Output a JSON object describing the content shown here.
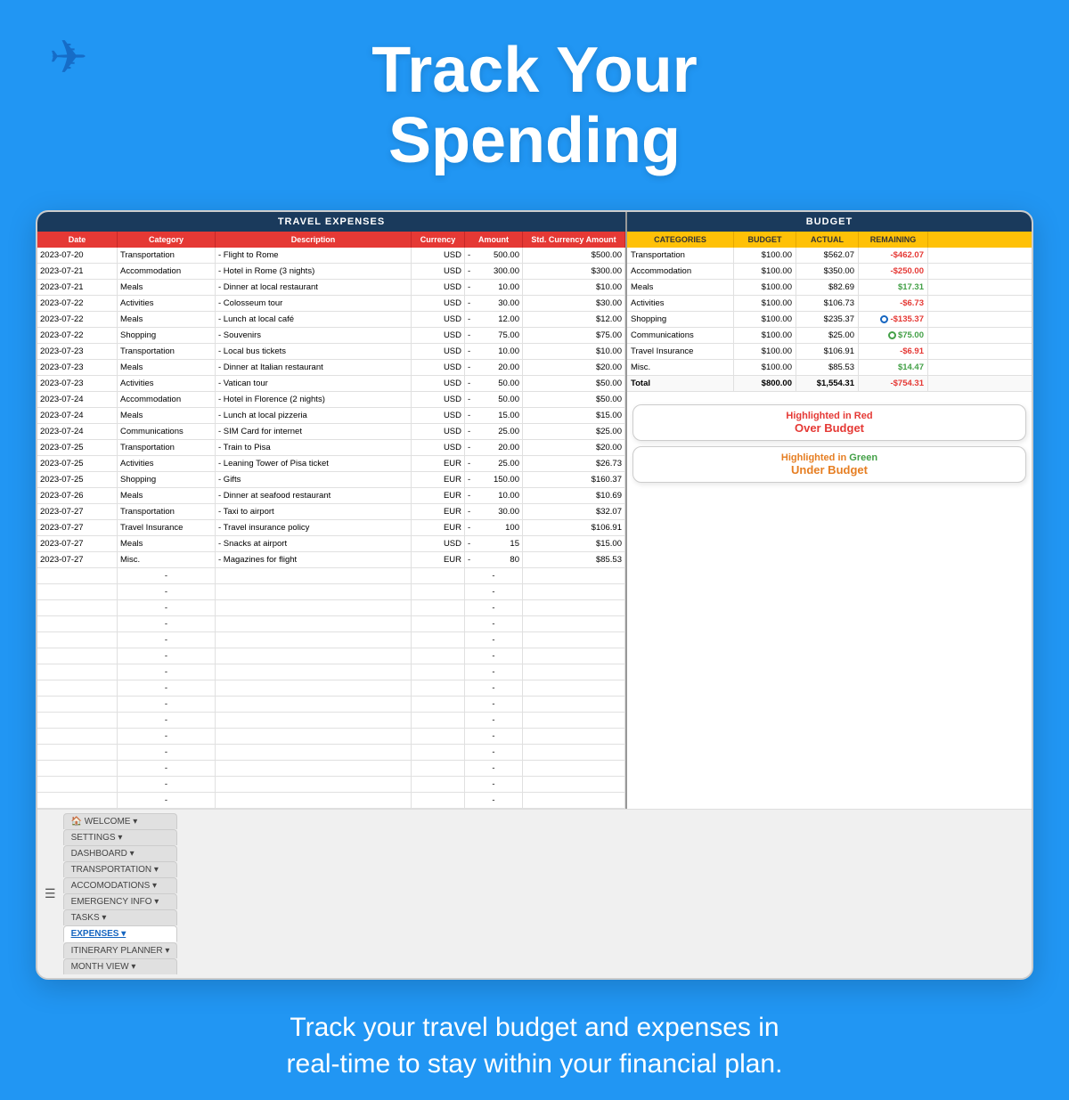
{
  "header": {
    "title_line1": "Track Your",
    "title_line2": "Spending"
  },
  "left_panel": {
    "title": "TRAVEL EXPENSES",
    "columns": [
      "Date",
      "Category",
      "Description",
      "Currency",
      "Amount",
      "Std. Currency Amount"
    ],
    "rows": [
      {
        "date": "2023-07-20",
        "category": "Transportation",
        "description": "- Flight to Rome",
        "currency": "USD",
        "dash": "-",
        "amount": "500.00",
        "std": "$500.00"
      },
      {
        "date": "2023-07-21",
        "category": "Accommodation",
        "description": "- Hotel in Rome (3 nights)",
        "currency": "USD",
        "dash": "-",
        "amount": "300.00",
        "std": "$300.00"
      },
      {
        "date": "2023-07-21",
        "category": "Meals",
        "description": "- Dinner at local restaurant",
        "currency": "USD",
        "dash": "-",
        "amount": "10.00",
        "std": "$10.00"
      },
      {
        "date": "2023-07-22",
        "category": "Activities",
        "description": "- Colosseum tour",
        "currency": "USD",
        "dash": "-",
        "amount": "30.00",
        "std": "$30.00"
      },
      {
        "date": "2023-07-22",
        "category": "Meals",
        "description": "- Lunch at local café",
        "currency": "USD",
        "dash": "-",
        "amount": "12.00",
        "std": "$12.00"
      },
      {
        "date": "2023-07-22",
        "category": "Shopping",
        "description": "- Souvenirs",
        "currency": "USD",
        "dash": "-",
        "amount": "75.00",
        "std": "$75.00"
      },
      {
        "date": "2023-07-23",
        "category": "Transportation",
        "description": "- Local bus tickets",
        "currency": "USD",
        "dash": "-",
        "amount": "10.00",
        "std": "$10.00"
      },
      {
        "date": "2023-07-23",
        "category": "Meals",
        "description": "- Dinner at Italian restaurant",
        "currency": "USD",
        "dash": "-",
        "amount": "20.00",
        "std": "$20.00"
      },
      {
        "date": "2023-07-23",
        "category": "Activities",
        "description": "- Vatican tour",
        "currency": "USD",
        "dash": "-",
        "amount": "50.00",
        "std": "$50.00"
      },
      {
        "date": "2023-07-24",
        "category": "Accommodation",
        "description": "- Hotel in Florence (2 nights)",
        "currency": "USD",
        "dash": "-",
        "amount": "50.00",
        "std": "$50.00"
      },
      {
        "date": "2023-07-24",
        "category": "Meals",
        "description": "- Lunch at local pizzeria",
        "currency": "USD",
        "dash": "-",
        "amount": "15.00",
        "std": "$15.00"
      },
      {
        "date": "2023-07-24",
        "category": "Communications",
        "description": "- SIM Card for internet",
        "currency": "USD",
        "dash": "-",
        "amount": "25.00",
        "std": "$25.00"
      },
      {
        "date": "2023-07-25",
        "category": "Transportation",
        "description": "- Train to Pisa",
        "currency": "USD",
        "dash": "-",
        "amount": "20.00",
        "std": "$20.00"
      },
      {
        "date": "2023-07-25",
        "category": "Activities",
        "description": "- Leaning Tower of Pisa ticket",
        "currency": "EUR",
        "dash": "-",
        "amount": "25.00",
        "std": "$26.73"
      },
      {
        "date": "2023-07-25",
        "category": "Shopping",
        "description": "- Gifts",
        "currency": "EUR",
        "dash": "-",
        "amount": "150.00",
        "std": "$160.37"
      },
      {
        "date": "2023-07-26",
        "category": "Meals",
        "description": "- Dinner at seafood restaurant",
        "currency": "EUR",
        "dash": "-",
        "amount": "10.00",
        "std": "$10.69"
      },
      {
        "date": "2023-07-27",
        "category": "Transportation",
        "description": "- Taxi to airport",
        "currency": "EUR",
        "dash": "-",
        "amount": "30.00",
        "std": "$32.07"
      },
      {
        "date": "2023-07-27",
        "category": "Travel Insurance",
        "description": "- Travel insurance policy",
        "currency": "EUR",
        "dash": "-",
        "amount": "100",
        "std": "$106.91"
      },
      {
        "date": "2023-07-27",
        "category": "Meals",
        "description": "- Snacks at airport",
        "currency": "USD",
        "dash": "-",
        "amount": "15",
        "std": "$15.00"
      },
      {
        "date": "2023-07-27",
        "category": "Misc.",
        "description": "- Magazines for flight",
        "currency": "EUR",
        "dash": "-",
        "amount": "80",
        "std": "$85.53"
      }
    ],
    "empty_rows": 15
  },
  "right_panel": {
    "title": "BUDGET",
    "columns": [
      "CATEGORIES",
      "BUDGET",
      "ACTUAL",
      "REMAINING"
    ],
    "rows": [
      {
        "category": "Transportation",
        "budget": "$100.00",
        "actual": "$562.07",
        "remaining": "-$462.07",
        "status": "over"
      },
      {
        "category": "Accommodation",
        "budget": "$100.00",
        "actual": "$350.00",
        "remaining": "-$250.00",
        "status": "over"
      },
      {
        "category": "Meals",
        "budget": "$100.00",
        "actual": "$82.69",
        "remaining": "$17.31",
        "status": "under"
      },
      {
        "category": "Activities",
        "budget": "$100.00",
        "actual": "$106.73",
        "remaining": "-$6.73",
        "status": "over"
      },
      {
        "category": "Shopping",
        "budget": "$100.00",
        "actual": "$235.37",
        "remaining": "-$135.37",
        "status": "over",
        "has_dot": true,
        "dot_color": "blue"
      },
      {
        "category": "Communications",
        "budget": "$100.00",
        "actual": "$25.00",
        "remaining": "$75.00",
        "status": "under",
        "has_dot": true,
        "dot_color": "green"
      },
      {
        "category": "Travel Insurance",
        "budget": "$100.00",
        "actual": "$106.91",
        "remaining": "-$6.91",
        "status": "over"
      },
      {
        "category": "Misc.",
        "budget": "$100.00",
        "actual": "$85.53",
        "remaining": "$14.47",
        "status": "under"
      }
    ],
    "total": {
      "label": "Total",
      "budget": "$800.00",
      "actual": "$1,554.31",
      "remaining": "-$754.31",
      "status": "over"
    }
  },
  "callouts": {
    "red_line1": "Highlighted in Red",
    "red_line2": "Over Budget",
    "green_line1": "Highlighted in Green",
    "green_line2": "Under Budget"
  },
  "tabs": {
    "menu_icon": "☰",
    "items": [
      {
        "label": "🏠 WELCOME ▾",
        "active": false
      },
      {
        "label": "SETTINGS ▾",
        "active": false
      },
      {
        "label": "DASHBOARD ▾",
        "active": false
      },
      {
        "label": "TRANSPORTATION ▾",
        "active": false
      },
      {
        "label": "ACCOMODATIONS ▾",
        "active": false
      },
      {
        "label": "EMERGENCY INFO ▾",
        "active": false
      },
      {
        "label": "TASKS ▾",
        "active": false
      },
      {
        "label": "EXPENSES ▾",
        "active": true
      },
      {
        "label": "ITINERARY PLANNER ▾",
        "active": false
      },
      {
        "label": "MONTH VIEW ▾",
        "active": false
      }
    ]
  },
  "footer": {
    "text_line1": "Track your travel budget and expenses in",
    "text_line2": "real-time to stay within your financial plan."
  },
  "colors": {
    "background": "#2196F3",
    "header_panel": "#1a3a5c",
    "col_header_left": "#e53935",
    "col_header_right": "#FFC107",
    "over_budget": "#e53935",
    "under_budget": "#43a047"
  }
}
